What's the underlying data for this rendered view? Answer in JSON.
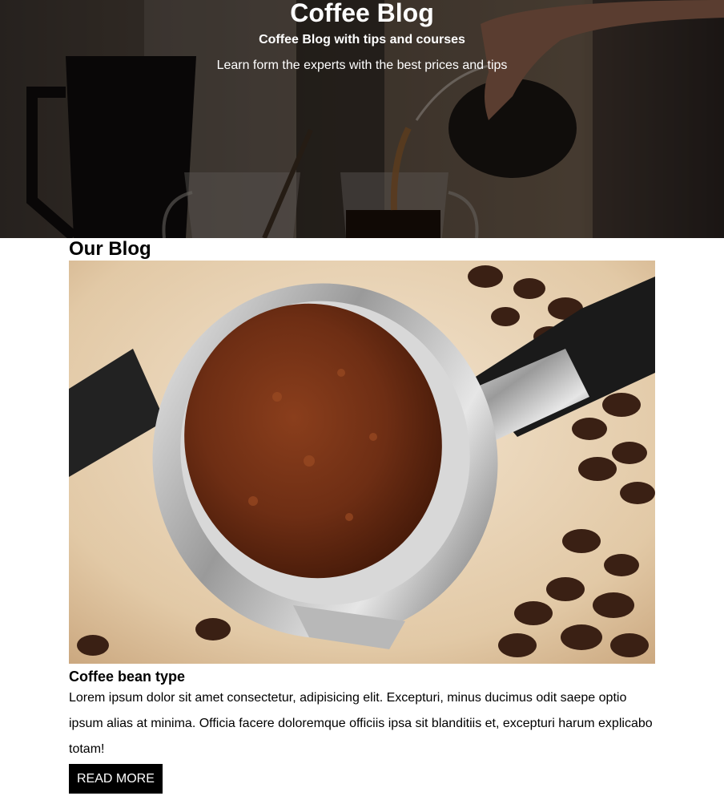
{
  "hero": {
    "title": "Coffee Blog",
    "subtitle": "Coffee Blog with tips and courses",
    "tagline": "Learn form the experts with the best prices and tips"
  },
  "blog": {
    "section_title": "Our Blog",
    "posts": [
      {
        "title": "Coffee bean type",
        "body": "Lorem ipsum dolor sit amet consectetur, adipisicing elit. Excepturi, minus ducimus odit saepe optio ipsum alias at minima. Officia facere doloremque officiis ipsa sit blanditiis et, excepturi harum explicabo totam!",
        "button_label": "READ MORE"
      }
    ]
  }
}
